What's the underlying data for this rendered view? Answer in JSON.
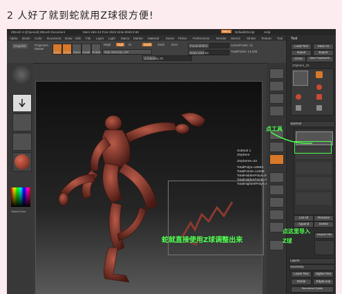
{
  "page": {
    "heading": "2 人好了就到蛇就用Z球很方便!"
  },
  "app": {
    "window_title": "ZBrush 3.1[Opened] ZBrush Document",
    "stats": "Mem 196+13 Free 3043 Zinte 8049 8 99",
    "menu_btn": "Menu",
    "default_script": "DefaultZScript",
    "help": "Help"
  },
  "menubar": [
    "Alpha",
    "Brush",
    "Color",
    "Document",
    "Draw",
    "Edit",
    "File",
    "Layer",
    "Light",
    "Macro",
    "Marker",
    "Material",
    "Movie",
    "Picker",
    "Preferences",
    "Render",
    "Stencil",
    "Stroke",
    "Texture",
    "Tool",
    "Transform",
    "Zplugin",
    "Zscript"
  ],
  "toolbar": {
    "zapplink": "ZApplink",
    "projection_master": "Projection Master",
    "edit": "Edit",
    "draw": "Draw",
    "move": "Move",
    "scale": "Scale",
    "rotate": "Rotate",
    "mrgb": "Mrgb",
    "rgb": "Rgb",
    "m": "M",
    "zadd": "Zadd",
    "zsub": "Zsub",
    "zcut": "Zcut",
    "rgb_intensity": "Rgb Intensity 100",
    "z_intensity": "Z Intensity 25",
    "focal_shift": "Focal Shift 0",
    "draw_size": "Draw Size 64",
    "active_points": "ActivePoints: 11",
    "total_points": "TotalPoints: 14,035"
  },
  "left_shelf": {
    "color_label": "SwitchColor"
  },
  "tool_panel": {
    "title": "Tool",
    "load_tool": "Load Tool",
    "save_as": "Save As",
    "import": "Import",
    "export": "Export",
    "clone": "Clone",
    "make_polymesh": "Make PolyMesh3D",
    "current_tool": "ZSphere_31",
    "tools": [
      "ZSphere",
      "SimpleBrush",
      "Sphere3D",
      "ZSphere",
      "PolyMesh3D",
      "Cyl",
      "PM3D_Cyl"
    ],
    "subtool": "SubTool",
    "list_all": "List All",
    "rename": "Rename",
    "append": "Append",
    "delete": "Delete",
    "adaptive_skin": "Adaptive Skin",
    "geometry": "Geometry",
    "layers": "Layers",
    "lower_res": "Lower Res",
    "higher_res": "Higher Res",
    "divide": "Divide",
    "reconstruct": "Reconstruct Subdiv",
    "edgeloop": "EdgeLoop"
  },
  "viewport_info": {
    "subtool": "Subtool 1",
    "name": "ZSphere",
    "zspheres": "ZSpheres=33",
    "total_polys": "TotalPolys=16664",
    "total_points": "TotalPoints=14835",
    "hidden_polys": "TotalHiddenPolys=0",
    "hidden_points": "TotalHiddenPoints=0",
    "highdef_polys": "TotalHighDefPolys=0"
  },
  "annotations": {
    "tool": "点工具",
    "import_zsphere": "点这里导入",
    "zsphere": "Z球",
    "snake_caption": "蛇就直接使用Z球调整出来"
  },
  "colors": {
    "accent": "#d8782a",
    "annotation": "#4fff4f",
    "figure": "#8b3a30"
  }
}
